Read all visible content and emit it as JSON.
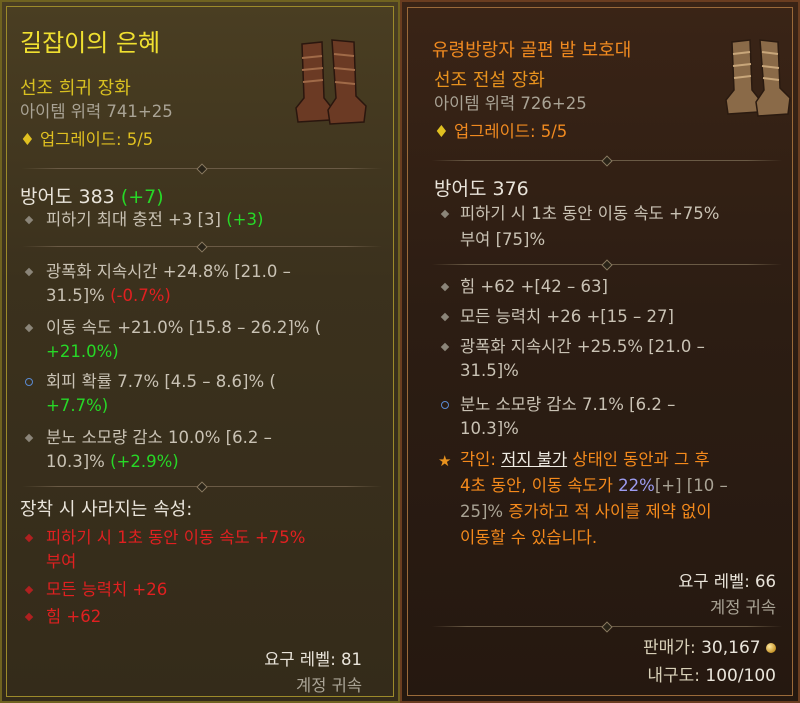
{
  "left": {
    "name": "길잡이의 은혜",
    "rarity": "선조 희귀 장화",
    "item_power": "아이템 위력 741+25",
    "upgrade": "업그레이드: 5/5",
    "armor_label": "방어도 383",
    "armor_bonus": "(+7)",
    "implicit_main": "피하기 최대 충전 +3 [3]",
    "implicit_bonus": "(+3)",
    "affixes": [
      {
        "l1": "광폭화 지속시간 +24.8% [21.0 –",
        "l2": "31.5]%",
        "d": "(-0.7%)"
      },
      {
        "l1": "이동 속도 +21.0% [15.8 – 26.2]% (",
        "d": "+21.0%)"
      },
      {
        "l1": "회피 확률 7.7% [4.5 – 8.6]% (",
        "d": "+7.7%)"
      },
      {
        "l1": "분노 소모량 감소 10.0% [6.2 –",
        "l2": "10.3]%",
        "d": "(+2.9%)"
      }
    ],
    "lost_title": "장착 시 사라지는 속성:",
    "lost": [
      "피하기 시 1초 동안 이동 속도 +75%",
      "부여",
      "모든 능력치 +26",
      "힘 +62"
    ],
    "req_level": "요구 레벨: 81",
    "bound": "계정 귀속"
  },
  "right": {
    "name": "유령방랑자 골편 발 보호대",
    "rarity": "선조 전설 장화",
    "item_power": "아이템 위력 726+25",
    "upgrade": "업그레이드: 5/5",
    "armor_label": "방어도 376",
    "implicit_l1": "피하기 시 1초 동안 이동 속도 +75%",
    "implicit_l2": "부여 [75]%",
    "affixes": [
      {
        "l1": "힘 +62 +[42 – 63]"
      },
      {
        "l1": "모든 능력치 +26 +[15 – 27]"
      },
      {
        "l1": "광폭화 지속시간 +25.5% [21.0 –",
        "l2": "31.5]%"
      },
      {
        "l1": "분노 소모량 감소 7.1% [6.2 –",
        "l2": "10.3]%"
      }
    ],
    "aspect_prefix": "각인:",
    "aspect_keyword": "저지 불가",
    "aspect_l1_rest": "상태인 동안과 그 후",
    "aspect_l2a": "4초 동안, 이동 속도가",
    "aspect_value": "22%",
    "aspect_range": "[+] [10 –",
    "aspect_l3a": "25]%",
    "aspect_l3b": "증가하고 적 사이를 제약 없이",
    "aspect_l4": "이동할 수 있습니다.",
    "req_level": "요구 레벨: 66",
    "bound": "계정 귀속",
    "sell_label": "판매가:",
    "sell_value": "30,167",
    "durability_label": "내구도:",
    "durability_value": "100/100"
  }
}
